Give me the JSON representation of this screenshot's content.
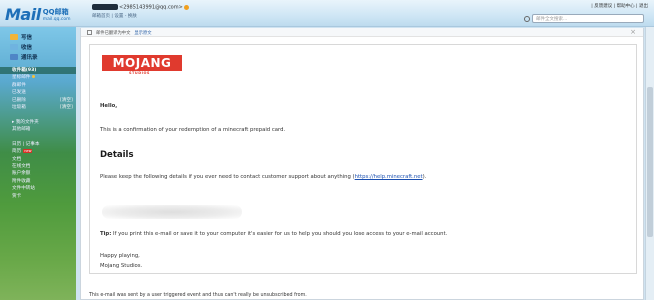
{
  "header": {
    "logo_text": "Mail",
    "logo_cn": "QQ邮箱",
    "logo_domain": "mail.qq.com",
    "account_email": "<2985143991@qq.com>",
    "account_links": "邮箱首页 | 设置 - 换肤",
    "top_links": "| 反馈建议 | 帮助中心 | 退出",
    "search_placeholder": "邮件全文搜索..."
  },
  "sidebar": {
    "actions": [
      {
        "label": "写信",
        "color": "#f0b43a"
      },
      {
        "label": "收信",
        "color": "#6fb3e0"
      },
      {
        "label": "通讯录",
        "color": "#4f86c6"
      }
    ],
    "items": [
      {
        "label": "收件箱(93)",
        "selected": true,
        "extra": ""
      },
      {
        "label": "星标邮件",
        "flag": true,
        "extra": ""
      },
      {
        "label": "群邮件",
        "extra": ""
      },
      {
        "label": "已发送",
        "extra": ""
      },
      {
        "label": "已删除",
        "extra": "[清空]"
      },
      {
        "label": "垃圾箱",
        "extra": "[清空]"
      },
      {
        "label": "",
        "extra": ""
      },
      {
        "label": "▸ 我的文件夹",
        "extra": ""
      },
      {
        "label": "其他邮箱",
        "extra": ""
      },
      {
        "label": "",
        "extra": ""
      },
      {
        "label": "日历 | 记事本",
        "extra": ""
      },
      {
        "label": "简历",
        "badge": "new",
        "extra": ""
      },
      {
        "label": "文档",
        "extra": ""
      },
      {
        "label": "在线文档",
        "extra": ""
      },
      {
        "label": "账户余额",
        "extra": ""
      },
      {
        "label": "附件收藏",
        "extra": ""
      },
      {
        "label": "文件中转站",
        "extra": ""
      },
      {
        "label": "贺卡",
        "extra": ""
      }
    ]
  },
  "panel": {
    "bar_text": "邮件已翻译为中文",
    "bar_link": "显示原文",
    "close": "×"
  },
  "email": {
    "brand": "MOJANG",
    "brand_sub": "STUDIOS",
    "greeting": "Hello,",
    "confirmation": "This is a confirmation of your redemption of a minecraft prepaid card.",
    "details_heading": "Details",
    "keep_text_before": "Please keep the following details if you ever need to contact customer support about anything (",
    "support_link": "https://help.minecraft.net",
    "keep_text_after": ").",
    "tip_label": "Tip:",
    "tip_text": " If you print this e-mail or save it to your computer it's easier for us to help you should you lose access to your e-mail account.",
    "happy": "Happy playing,",
    "signature": "Mojang Studios."
  },
  "footer": "This e-mail was sent by a user triggered event and thus can't really be unsubscribed from.",
  "colors": {
    "brand_red": "#e03a2e",
    "link_blue": "#1a4fb0"
  }
}
